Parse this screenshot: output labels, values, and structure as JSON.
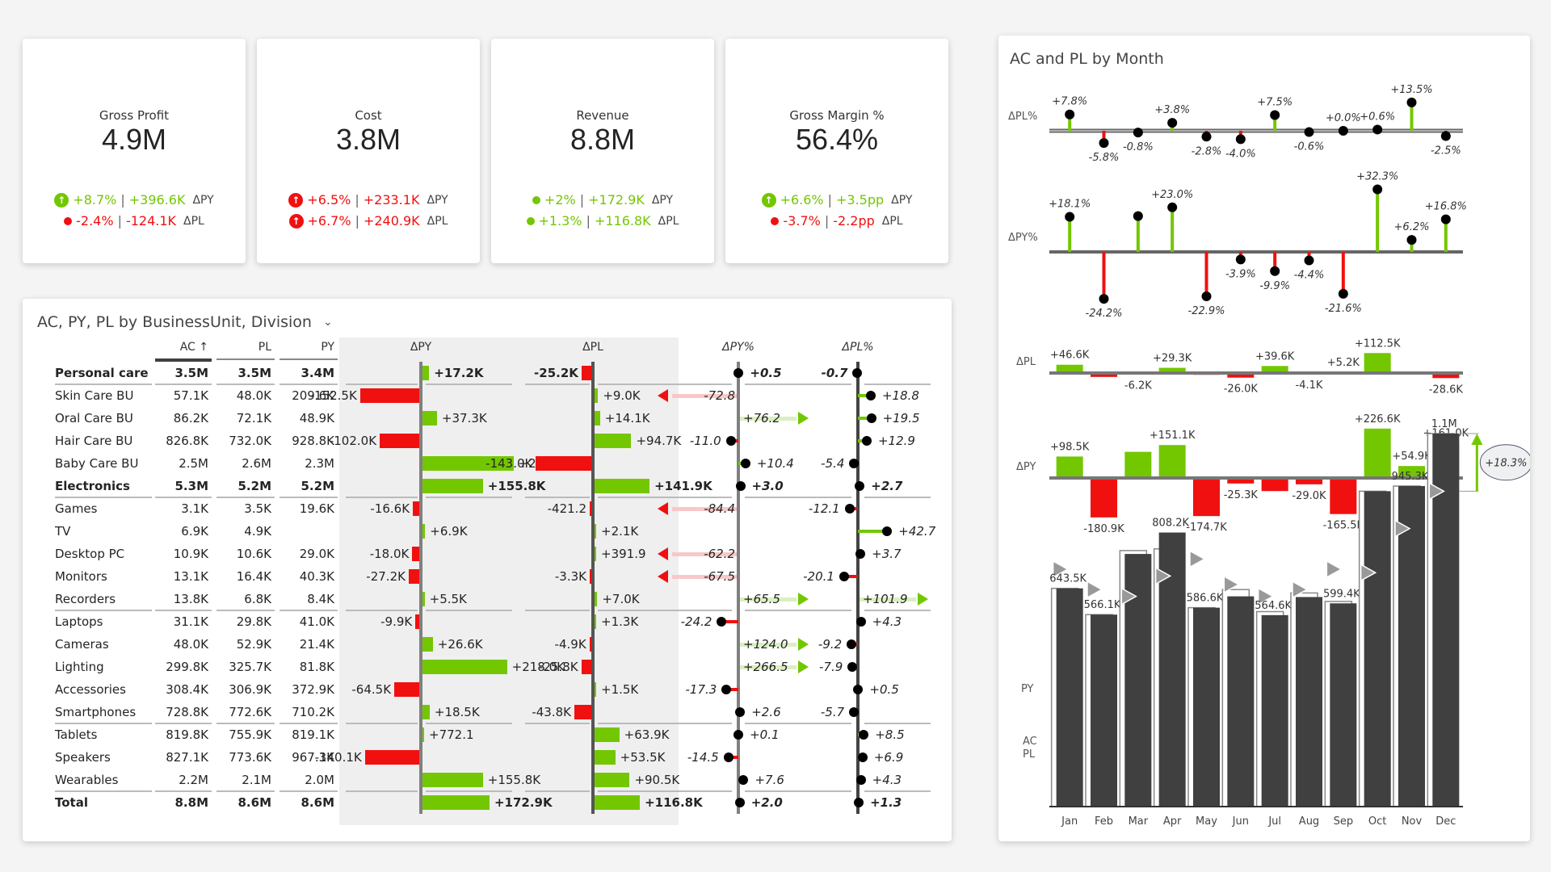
{
  "kpis": [
    {
      "title": "Gross Profit",
      "value": "4.9M",
      "py": {
        "pct": "+8.7%",
        "abs": "+396.6K",
        "label": "ΔPY",
        "color": "green",
        "icon": "arrow-up-icon",
        "icon_size": "large"
      },
      "pl": {
        "pct": "-2.4%",
        "abs": "-124.1K",
        "label": "ΔPL",
        "color": "red",
        "icon": "arrow-down-icon",
        "icon_size": "small"
      }
    },
    {
      "title": "Cost",
      "value": "3.8M",
      "py": {
        "pct": "+6.5%",
        "abs": "+233.1K",
        "label": "ΔPY",
        "color": "red",
        "icon": "arrow-up-icon",
        "icon_size": "large"
      },
      "pl": {
        "pct": "+6.7%",
        "abs": "+240.9K",
        "label": "ΔPL",
        "color": "red",
        "icon": "arrow-up-icon",
        "icon_size": "large"
      }
    },
    {
      "title": "Revenue",
      "value": "8.8M",
      "py": {
        "pct": "+2%",
        "abs": "+172.9K",
        "label": "ΔPY",
        "color": "green",
        "icon": "arrow-up-icon",
        "icon_size": "small"
      },
      "pl": {
        "pct": "+1.3%",
        "abs": "+116.8K",
        "label": "ΔPL",
        "color": "green",
        "icon": "arrow-up-icon",
        "icon_size": "tiny"
      }
    },
    {
      "title": "Gross Margin %",
      "value": "56.4%",
      "py": {
        "pct": "+6.6%",
        "abs": "+3.5pp",
        "label": "ΔPY",
        "color": "green",
        "icon": "arrow-up-icon",
        "icon_size": "large"
      },
      "pl": {
        "pct": "-3.7%",
        "abs": "-2.2pp",
        "label": "ΔPL",
        "color": "red",
        "icon": "arrow-down-icon",
        "icon_size": "small"
      }
    }
  ],
  "colors": {
    "positive": "#73c700",
    "negative": "#f01010",
    "bar_ac": "#404040",
    "axis": "#808080"
  },
  "table": {
    "title": "AC, PY, PL by BusinessUnit, Division",
    "dropdown_icon": "chevron-down-icon",
    "headers": {
      "ac": "AC ↑",
      "pl": "PL",
      "py": "PY",
      "dpy": "ΔPY",
      "dpl": "ΔPL",
      "dpy_pct": "ΔPY%",
      "dpl_pct": "ΔPL%"
    },
    "rows": [
      {
        "name": "Personal care",
        "bold": true,
        "ac": "3.5M",
        "pl": "3.5M",
        "py": "3.4M",
        "dpy": 17.2,
        "dpy_label": "+17.2K",
        "dpl": -25.2,
        "dpl_label": "-25.2K",
        "dpy_pct": 0.5,
        "dpy_pct_label": "+0.5",
        "dpl_pct": -0.7,
        "dpl_pct_label": "-0.7",
        "sep_after": true
      },
      {
        "name": "Skin Care BU",
        "ac": "57.1K",
        "pl": "48.0K",
        "py": "209.6K",
        "dpy": -152.5,
        "dpy_label": "-152.5K",
        "dpl": 9.0,
        "dpl_label": "+9.0K",
        "dpy_pct": -72.8,
        "dpy_pct_label": "-72.8",
        "dpl_pct": 18.8,
        "dpl_pct_label": "+18.8"
      },
      {
        "name": "Oral Care BU",
        "ac": "86.2K",
        "pl": "72.1K",
        "py": "48.9K",
        "dpy": 37.3,
        "dpy_label": "+37.3K",
        "dpl": 14.1,
        "dpl_label": "+14.1K",
        "dpy_pct": 76.2,
        "dpy_pct_label": "+76.2",
        "dpl_pct": 19.5,
        "dpl_pct_label": "+19.5"
      },
      {
        "name": "Hair Care BU",
        "ac": "826.8K",
        "pl": "732.0K",
        "py": "928.8K",
        "dpy": -102.0,
        "dpy_label": "-102.0K",
        "dpl": 94.7,
        "dpl_label": "+94.7K",
        "dpy_pct": -11.0,
        "dpy_pct_label": "-11.0",
        "dpl_pct": 12.9,
        "dpl_pct_label": "+12.9"
      },
      {
        "name": "Baby Care BU",
        "ac": "2.5M",
        "pl": "2.6M",
        "py": "2.3M",
        "dpy": 234.4,
        "dpy_label": "+234.4K",
        "dpl": -143.0,
        "dpl_label": "-143.0K",
        "dpy_pct": 10.4,
        "dpy_pct_label": "+10.4",
        "dpl_pct": -5.4,
        "dpl_pct_label": "-5.4"
      },
      {
        "name": "Electronics",
        "bold": true,
        "ac": "5.3M",
        "pl": "5.2M",
        "py": "5.2M",
        "dpy": 155.8,
        "dpy_label": "+155.8K",
        "dpl": 141.9,
        "dpl_label": "+141.9K",
        "dpy_pct": 3.0,
        "dpy_pct_label": "+3.0",
        "dpl_pct": 2.7,
        "dpl_pct_label": "+2.7",
        "sep_after": true
      },
      {
        "name": "Games",
        "ac": "3.1K",
        "pl": "3.5K",
        "py": "19.6K",
        "dpy": -16.6,
        "dpy_label": "-16.6K",
        "dpl": -0.4212,
        "dpl_label": "-421.2",
        "dpy_pct": -84.4,
        "dpy_pct_label": "-84.4",
        "dpl_pct": -12.1,
        "dpl_pct_label": "-12.1"
      },
      {
        "name": "TV",
        "ac": "6.9K",
        "pl": "4.9K",
        "py": "",
        "dpy": 6.9,
        "dpy_label": "+6.9K",
        "dpl": 2.1,
        "dpl_label": "+2.1K",
        "dpy_pct": null,
        "dpy_pct_label": "",
        "dpl_pct": 42.7,
        "dpl_pct_label": "+42.7"
      },
      {
        "name": "Desktop PC",
        "ac": "10.9K",
        "pl": "10.6K",
        "py": "29.0K",
        "dpy": -18.0,
        "dpy_label": "-18.0K",
        "dpl": 0.3919,
        "dpl_label": "+391.9",
        "dpy_pct": -62.2,
        "dpy_pct_label": "-62.2",
        "dpl_pct": 3.7,
        "dpl_pct_label": "+3.7"
      },
      {
        "name": "Monitors",
        "ac": "13.1K",
        "pl": "16.4K",
        "py": "40.3K",
        "dpy": -27.2,
        "dpy_label": "-27.2K",
        "dpl": -3.3,
        "dpl_label": "-3.3K",
        "dpy_pct": -67.5,
        "dpy_pct_label": "-67.5",
        "dpl_pct": -20.1,
        "dpl_pct_label": "-20.1"
      },
      {
        "name": "Recorders",
        "ac": "13.8K",
        "pl": "6.8K",
        "py": "8.4K",
        "dpy": 5.5,
        "dpy_label": "+5.5K",
        "dpl": 7.0,
        "dpl_label": "+7.0K",
        "dpy_pct": 65.5,
        "dpy_pct_label": "+65.5",
        "dpl_pct": 101.9,
        "dpl_pct_label": "+101.9",
        "sep_after": true
      },
      {
        "name": "Laptops",
        "ac": "31.1K",
        "pl": "29.8K",
        "py": "41.0K",
        "dpy": -9.9,
        "dpy_label": "-9.9K",
        "dpl": 1.3,
        "dpl_label": "+1.3K",
        "dpy_pct": -24.2,
        "dpy_pct_label": "-24.2",
        "dpl_pct": 4.3,
        "dpl_pct_label": "+4.3"
      },
      {
        "name": "Cameras",
        "ac": "48.0K",
        "pl": "52.9K",
        "py": "21.4K",
        "dpy": 26.6,
        "dpy_label": "+26.6K",
        "dpl": -4.9,
        "dpl_label": "-4.9K",
        "dpy_pct": 124.0,
        "dpy_pct_label": "+124.0",
        "dpl_pct": -9.2,
        "dpl_pct_label": "-9.2"
      },
      {
        "name": "Lighting",
        "ac": "299.8K",
        "pl": "325.7K",
        "py": "81.8K",
        "dpy": 218.0,
        "dpy_label": "+218.0K",
        "dpl": -25.8,
        "dpl_label": "-25.8K",
        "dpy_pct": 266.5,
        "dpy_pct_label": "+266.5",
        "dpl_pct": -7.9,
        "dpl_pct_label": "-7.9"
      },
      {
        "name": "Accessories",
        "ac": "308.4K",
        "pl": "306.9K",
        "py": "372.9K",
        "dpy": -64.5,
        "dpy_label": "-64.5K",
        "dpl": 1.5,
        "dpl_label": "+1.5K",
        "dpy_pct": -17.3,
        "dpy_pct_label": "-17.3",
        "dpl_pct": 0.5,
        "dpl_pct_label": "+0.5"
      },
      {
        "name": "Smartphones",
        "ac": "728.8K",
        "pl": "772.6K",
        "py": "710.2K",
        "dpy": 18.5,
        "dpy_label": "+18.5K",
        "dpl": -43.8,
        "dpl_label": "-43.8K",
        "dpy_pct": 2.6,
        "dpy_pct_label": "+2.6",
        "dpl_pct": -5.7,
        "dpl_pct_label": "-5.7",
        "sep_after": true
      },
      {
        "name": "Tablets",
        "ac": "819.8K",
        "pl": "755.9K",
        "py": "819.1K",
        "dpy": 0.7721,
        "dpy_label": "+772.1",
        "dpl": 63.9,
        "dpl_label": "+63.9K",
        "dpy_pct": 0.1,
        "dpy_pct_label": "+0.1",
        "dpl_pct": 8.5,
        "dpl_pct_label": "+8.5"
      },
      {
        "name": "Speakers",
        "ac": "827.1K",
        "pl": "773.6K",
        "py": "967.3K",
        "dpy": -140.1,
        "dpy_label": "-140.1K",
        "dpl": 53.5,
        "dpl_label": "+53.5K",
        "dpy_pct": -14.5,
        "dpy_pct_label": "-14.5",
        "dpl_pct": 6.9,
        "dpl_pct_label": "+6.9"
      },
      {
        "name": "Wearables",
        "ac": "2.2M",
        "pl": "2.1M",
        "py": "2.0M",
        "dpy": 155.8,
        "dpy_label": "+155.8K",
        "dpl": 90.5,
        "dpl_label": "+90.5K",
        "dpy_pct": 7.6,
        "dpy_pct_label": "+7.6",
        "dpl_pct": 4.3,
        "dpl_pct_label": "+4.3",
        "sep_after": true
      },
      {
        "name": "Total",
        "bold": true,
        "ac": "8.8M",
        "pl": "8.6M",
        "py": "8.6M",
        "dpy": 172.9,
        "dpy_label": "+172.9K",
        "dpl": 116.8,
        "dpl_label": "+116.8K",
        "dpy_pct": 2.0,
        "dpy_pct_label": "+2.0",
        "dpl_pct": 1.3,
        "dpl_pct_label": "+1.3"
      }
    ]
  },
  "chart_data": {
    "type": "bar",
    "title": "AC and PL by Month",
    "categories": [
      "Jan",
      "Feb",
      "Mar",
      "Apr",
      "May",
      "Jun",
      "Jul",
      "Aug",
      "Sep",
      "Oct",
      "Nov",
      "Dec"
    ],
    "panels": [
      {
        "name": "ΔPL%",
        "type": "pin",
        "values": [
          7.8,
          -5.8,
          -0.8,
          3.8,
          -2.8,
          -4.0,
          7.5,
          -0.6,
          0.0,
          0.6,
          13.5,
          -2.5
        ],
        "labels": [
          "+7.8%",
          "-5.8%",
          "-0.8%",
          "+3.8%",
          "-2.8%",
          "-4.0%",
          "+7.5%",
          "-0.6%",
          "+0.0%",
          "+0.6%",
          "+13.5%",
          "-2.5%"
        ]
      },
      {
        "name": "ΔPY%",
        "type": "pin",
        "values": [
          18.1,
          -24.2,
          18.5,
          23.0,
          -22.9,
          -3.9,
          -9.9,
          -4.4,
          -21.6,
          32.3,
          6.2,
          16.8
        ],
        "labels": [
          "+18.1%",
          "-24.2%",
          "",
          "+23.0%",
          "-22.9%",
          "-3.9%",
          "-9.9%",
          "-4.4%",
          "-21.6%",
          "+32.3%",
          "+6.2%",
          "+16.8%"
        ]
      },
      {
        "name": "ΔPL",
        "type": "bar",
        "values": [
          46.6,
          -22.0,
          -6.2,
          29.3,
          -10.0,
          -26.0,
          39.6,
          -4.1,
          5.2,
          112.5,
          0,
          -28.6
        ],
        "labels": [
          "+46.6K",
          "",
          "-6.2K",
          "+29.3K",
          "",
          "-26.0K",
          "+39.6K",
          "-4.1K",
          "+5.2K",
          "+112.5K",
          "",
          "-28.6K"
        ]
      },
      {
        "name": "ΔPY",
        "type": "bar",
        "values": [
          98.5,
          -180.9,
          120.0,
          151.1,
          -174.7,
          -25.3,
          -60.0,
          -29.0,
          -165.5,
          226.6,
          54.9,
          161.0
        ],
        "labels": [
          "+98.5K",
          "-180.9K",
          "",
          "+151.1K",
          "-174.7K",
          "-25.3K",
          "",
          "-29.0K",
          "-165.5K",
          "+226.6K",
          "+54.9K",
          "+161.0K"
        ]
      }
    ],
    "ac_series": {
      "name": "AC",
      "values": [
        643.5,
        566.1,
        745,
        808.2,
        586.6,
        620,
        564.6,
        618,
        599.4,
        930,
        945.3,
        1100
      ],
      "labels": [
        "643.5K",
        "566.1K",
        "",
        "808.2K",
        "586.6K",
        "",
        "564.6K",
        "",
        "599.4K",
        "",
        "945.3K",
        "1.1M"
      ]
    },
    "py_markers": [
      700,
      640,
      620,
      680,
      730,
      655,
      620,
      640,
      700,
      690,
      820,
      930
    ],
    "pl_outline": [
      643.5,
      566.1,
      755,
      760,
      586.6,
      640,
      575,
      630,
      605,
      930,
      945.3,
      1100
    ],
    "row_labels": {
      "py": "PY",
      "ac_pl": "AC\nPL"
    },
    "annotation": "+18.3%",
    "ylim": [
      0,
      1150
    ]
  }
}
